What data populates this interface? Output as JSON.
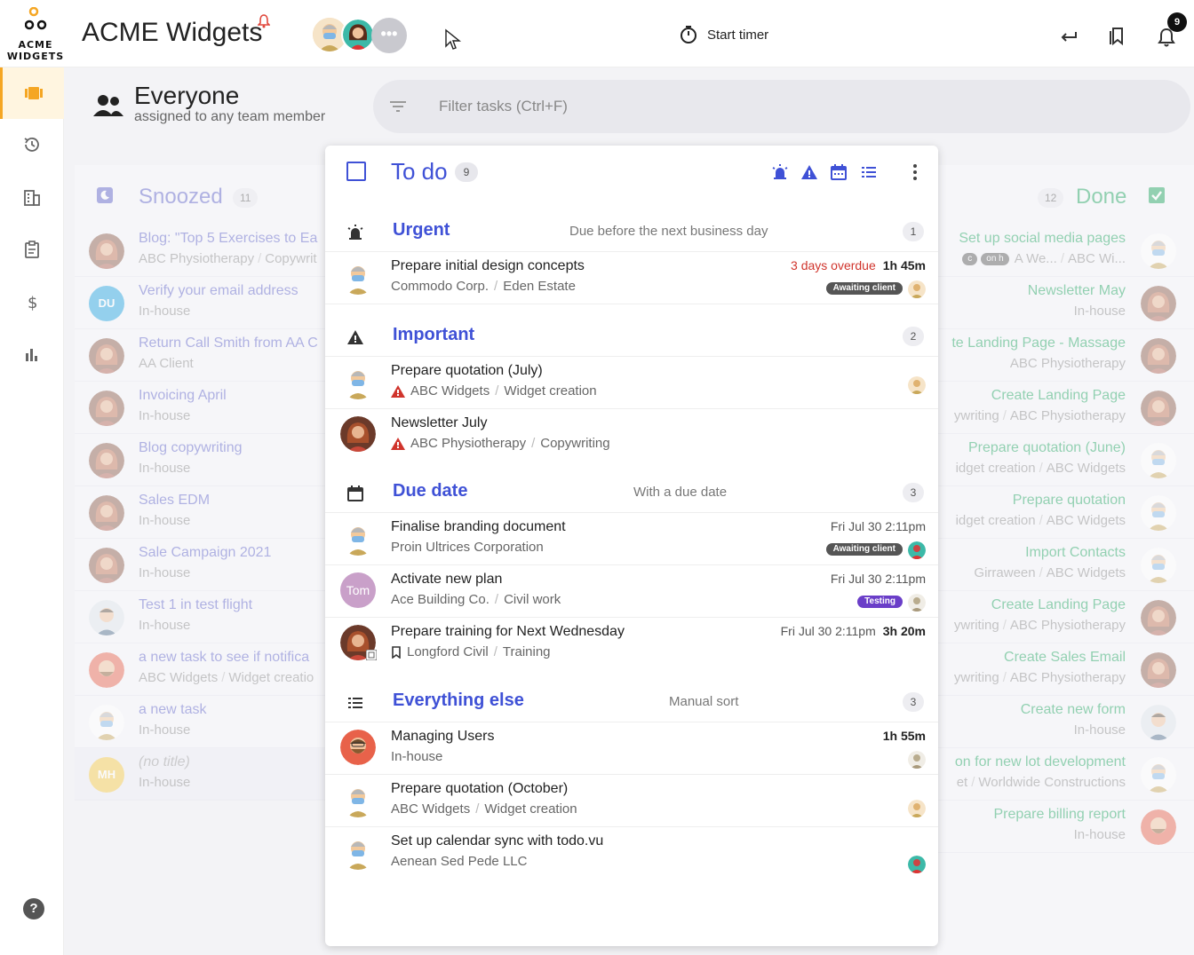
{
  "app": {
    "logo_text": "ACME WIDGETS",
    "title": "ACME Widgets",
    "more_label": "•••",
    "timer_label": "Start timer",
    "notification_count": "9",
    "help_label": "?"
  },
  "header": {
    "title": "Everyone",
    "subtitle": "assigned to any team member",
    "filter_placeholder": "Filter tasks (Ctrl+F)"
  },
  "snoozed": {
    "title": "Snoozed",
    "count": "11",
    "items": [
      {
        "title": "Blog: \"Top 5 Exercises to Ea",
        "client": "ABC Physiotherapy",
        "project": "Copywrit",
        "avatar": "woman"
      },
      {
        "title": "Verify your email address",
        "client": "In-house",
        "project": "",
        "avatar": "DU"
      },
      {
        "title": "Return Call Smith from AA C",
        "client": "AA Client",
        "project": "",
        "avatar": "woman"
      },
      {
        "title": "Invoicing April",
        "client": "In-house",
        "project": "",
        "avatar": "woman"
      },
      {
        "title": "Blog copywriting",
        "client": "In-house",
        "project": "",
        "avatar": "woman"
      },
      {
        "title": "Sales EDM",
        "client": "In-house",
        "project": "",
        "avatar": "woman"
      },
      {
        "title": "Sale Campaign 2021",
        "client": "In-house",
        "project": "",
        "avatar": "woman"
      },
      {
        "title": "Test 1 in test flight",
        "client": "In-house",
        "project": "",
        "avatar": "man"
      },
      {
        "title": "a new task to see if notifica",
        "client": "ABC Widgets",
        "project": "Widget creatio",
        "avatar": "redman"
      },
      {
        "title": "a new task",
        "client": "In-house",
        "project": "",
        "avatar": "mask"
      },
      {
        "title": "(no title)",
        "client": "In-house",
        "project": "",
        "avatar": "MH"
      }
    ]
  },
  "todo": {
    "title": "To do",
    "count": "9",
    "groups": [
      {
        "title": "Urgent",
        "description": "Due before the next business day",
        "count": "1",
        "tasks": [
          {
            "title": "Prepare initial design concepts",
            "client": "Commodo Corp.",
            "project": "Eden Estate",
            "overdue": "3 days overdue",
            "duration": "1h 45m",
            "tag": "Awaiting client"
          }
        ]
      },
      {
        "title": "Important",
        "description": "",
        "count": "2",
        "tasks": [
          {
            "title": "Prepare quotation (July)",
            "client": "ABC Widgets",
            "project": "Widget creation"
          },
          {
            "title": "Newsletter July",
            "client": "ABC Physiotherapy",
            "project": "Copywriting"
          }
        ]
      },
      {
        "title": "Due date",
        "description": "With a due date",
        "count": "3",
        "tasks": [
          {
            "title": "Finalise branding document",
            "client": "Proin Ultrices Corporation",
            "project": "",
            "due": "Fri Jul 30 2:11pm",
            "tag": "Awaiting client"
          },
          {
            "title": "Activate new plan",
            "client": "Ace Building Co.",
            "project": "Civil work",
            "due": "Fri Jul 30 2:11pm",
            "tag": "Testing",
            "avatar_text": "Tom"
          },
          {
            "title": "Prepare training for Next Wednesday",
            "client": "Longford Civil",
            "project": "Training",
            "due": "Fri Jul 30 2:11pm",
            "duration": "3h 20m"
          }
        ]
      },
      {
        "title": "Everything else",
        "description": "Manual sort",
        "count": "3",
        "tasks": [
          {
            "title": "Managing Users",
            "client": "In-house",
            "project": "",
            "duration": "1h 55m"
          },
          {
            "title": "Prepare quotation (October)",
            "client": "ABC Widgets",
            "project": "Widget creation"
          },
          {
            "title": "Set up calendar sync with todo.vu",
            "client": "Aenean Sed Pede LLC",
            "project": ""
          }
        ]
      }
    ]
  },
  "done": {
    "title": "Done",
    "count": "12",
    "items": [
      {
        "title": "Set up social media pages",
        "client": "ABC Wi...",
        "project": "A We...",
        "tag": "on h",
        "tag2": "c"
      },
      {
        "title": "Newsletter May",
        "client": "In-house",
        "project": ""
      },
      {
        "title": "te Landing Page - Massage",
        "client": "ABC Physiotherapy",
        "project": ""
      },
      {
        "title": "Create Landing Page",
        "client": "ABC Physiotherapy",
        "project": "ywriting"
      },
      {
        "title": "Prepare quotation (June)",
        "client": "ABC Widgets",
        "project": "idget creation"
      },
      {
        "title": "Prepare quotation",
        "client": "ABC Widgets",
        "project": "idget creation"
      },
      {
        "title": "Import Contacts",
        "client": "ABC Widgets",
        "project": "Girraween"
      },
      {
        "title": "Create Landing Page",
        "client": "ABC Physiotherapy",
        "project": "ywriting"
      },
      {
        "title": "Create Sales Email",
        "client": "ABC Physiotherapy",
        "project": "ywriting"
      },
      {
        "title": "Create new form",
        "client": "In-house",
        "project": ""
      },
      {
        "title": "on for new lot development",
        "client": "Worldwide Constructions",
        "project": "et"
      },
      {
        "title": "Prepare billing report",
        "client": "In-house",
        "project": ""
      }
    ]
  },
  "colors": {
    "accent": "#3f51d6",
    "snoozed": "#5b5fc7",
    "done": "#1aa45c",
    "overdue": "#d0342c",
    "nav_active": "#f5a623"
  }
}
